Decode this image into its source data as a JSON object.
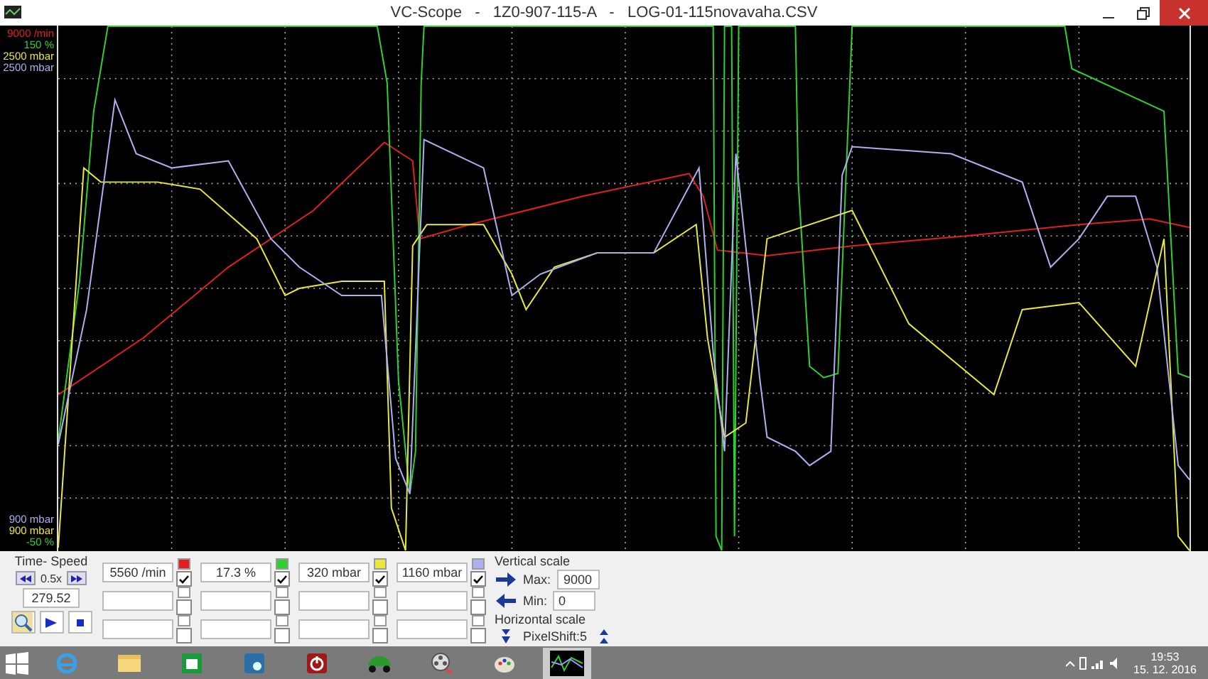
{
  "window": {
    "title": "VC-Scope   -   1Z0-907-115-A   -   LOG-01-115novavaha.CSV"
  },
  "scope": {
    "channels": [
      {
        "color": "#e02020",
        "top_label": "9000 /min",
        "reading": "5560 /min",
        "checked": true
      },
      {
        "color": "#30d030",
        "top_label": "150 %",
        "reading": "17.3 %",
        "checked": true
      },
      {
        "color": "#e8e840",
        "top_label": "2500 mbar",
        "reading": "320 mbar",
        "checked": true
      },
      {
        "color": "#b0b0f0",
        "top_label": "2500 mbar",
        "reading": "1160 mbar",
        "checked": true
      }
    ],
    "bottom_labels": [
      {
        "text": "900 mbar",
        "color": "#b0b0f0"
      },
      {
        "text": "900 mbar",
        "color": "#e8e840"
      },
      {
        "text": "-50 %",
        "color": "#30d030"
      }
    ]
  },
  "time_speed": {
    "title": "Time- Speed",
    "speed": "0.5x",
    "time": "279.52"
  },
  "empty_rows": [
    [
      {
        "checked": false
      },
      {
        "checked": false
      },
      {
        "checked": false
      },
      {
        "checked": false
      }
    ],
    [
      {
        "checked": false
      },
      {
        "checked": false
      },
      {
        "checked": false
      },
      {
        "checked": false
      }
    ]
  ],
  "vertical_scale": {
    "title": "Vertical scale",
    "max_label": "Max:",
    "max": "9000",
    "min_label": "Min:",
    "min": "0"
  },
  "horizontal_scale": {
    "title": "Horizontal scale",
    "value": "PixelShift:5"
  },
  "taskbar": {
    "apps": [
      {
        "kind": "browser",
        "selected": false
      },
      {
        "kind": "folder",
        "selected": false
      },
      {
        "kind": "store",
        "selected": false
      },
      {
        "kind": "tool",
        "selected": false
      },
      {
        "kind": "power",
        "selected": false
      },
      {
        "kind": "car",
        "selected": false
      },
      {
        "kind": "media",
        "selected": false
      },
      {
        "kind": "paint",
        "selected": false
      },
      {
        "kind": "scope",
        "selected": true
      }
    ],
    "time": "19:53",
    "date": "15. 12. 2016"
  }
}
